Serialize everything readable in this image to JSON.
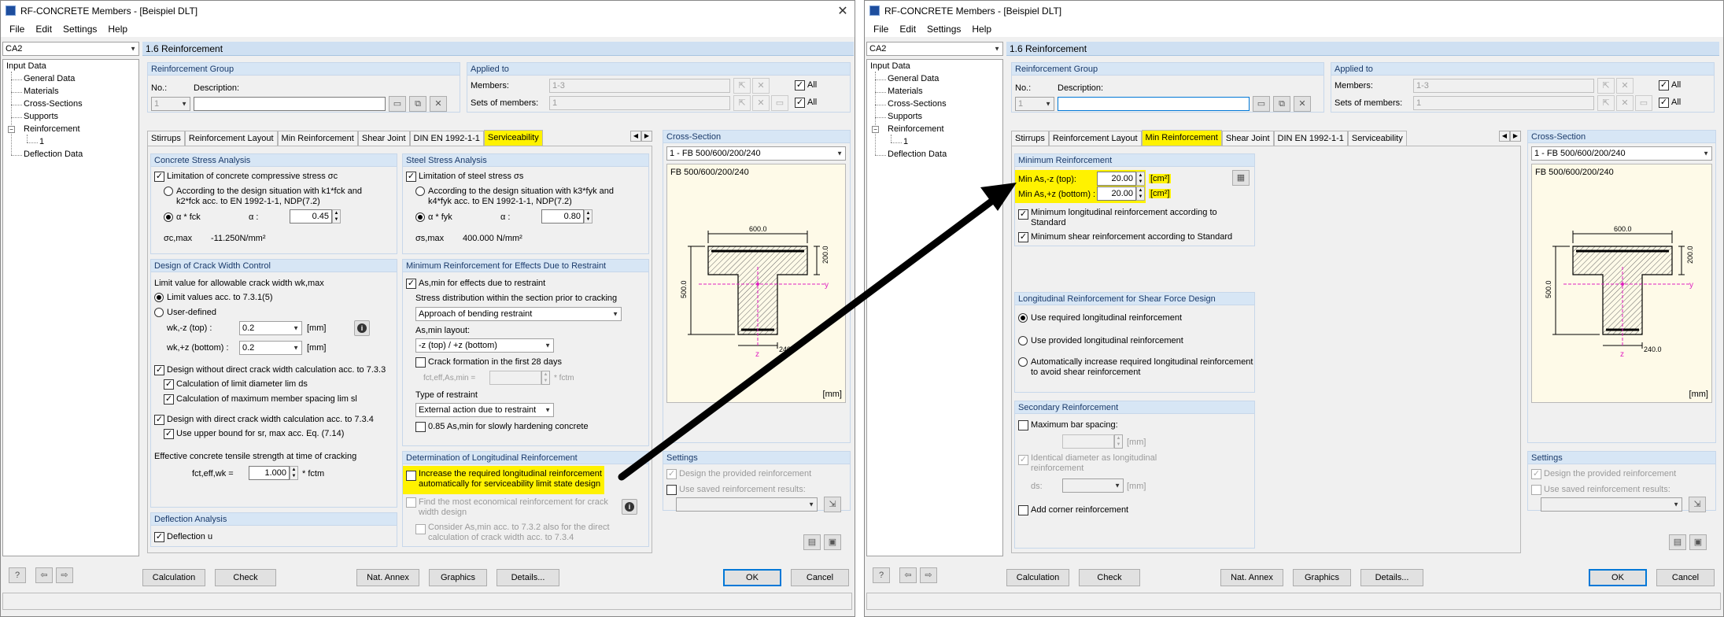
{
  "left": {
    "window_title": "RF-CONCRETE Members - [Beispiel DLT]",
    "menu": [
      "File",
      "Edit",
      "Settings",
      "Help"
    ],
    "case_combo": "CA2",
    "tree": {
      "root": "Input Data",
      "items": [
        "General Data",
        "Materials",
        "Cross-Sections",
        "Supports",
        "Reinforcement",
        "1",
        "Deflection Data"
      ]
    },
    "section_header": "1.6 Reinforcement",
    "reinf_group": {
      "title": "Reinforcement Group",
      "no_label": "No.:",
      "no_value": "1",
      "desc_label": "Description:",
      "desc_value": ""
    },
    "applied_to": {
      "title": "Applied to",
      "members_label": "Members:",
      "members_value": "1-3",
      "sets_label": "Sets of members:",
      "sets_value": "1",
      "all_label": "All"
    },
    "tabs": [
      "Stirrups",
      "Reinforcement Layout",
      "Min Reinforcement",
      "Shear Joint",
      "DIN EN 1992-1-1",
      "Serviceability"
    ],
    "active_tab": "Serviceability",
    "concrete_stress": {
      "title": "Concrete Stress Analysis",
      "limit_label": "Limitation of concrete compressive stress σc",
      "opt1_l1": "According to the design situation with k1*fck and",
      "opt1_l2": "k2*fck acc. to EN 1992-1-1, NDP(7.2)",
      "opt2": "α * fck",
      "alpha_label": "α :",
      "alpha_value": "0.45",
      "sigma_label": "σc,max",
      "sigma_value": "-11.250N/mm²"
    },
    "steel_stress": {
      "title": "Steel Stress Analysis",
      "limit_label": "Limitation of steel stress σs",
      "opt1_l1": "According to the design situation with k3*fyk and",
      "opt1_l2": "k4*fyk acc. to EN 1992-1-1, NDP(7.2)",
      "opt2": "α * fyk",
      "alpha_label": "α :",
      "alpha_value": "0.80",
      "sigma_label": "σs,max",
      "sigma_value": "400.000 N/mm²"
    },
    "crack_width": {
      "title": "Design of Crack Width Control",
      "limit_text": "Limit value for allowable crack width wk,max",
      "opt1": "Limit values acc. to 7.3.1(5)",
      "opt2": "User-defined",
      "wk_top_label": "wk,-z (top) :",
      "wk_top_value": "0.2",
      "wk_bot_label": "wk,+z (bottom) :",
      "wk_bot_value": "0.2",
      "unit": "[mm]",
      "without_direct": "Design without direct crack width calculation acc. to 7.3.3",
      "calc_limit": "Calculation of limit diameter lim ds",
      "calc_max": "Calculation of maximum member spacing lim sl",
      "with_direct": "Design with direct crack width calculation acc. to 7.3.4",
      "upper_bound": "Use upper bound for sr, max acc. Eq. (7.14)",
      "eff_label": "Effective concrete tensile strength at time of cracking",
      "fct_label": "fct,eff,wk =",
      "fct_value": "1.000",
      "fct_unit": "* fctm"
    },
    "deflection": {
      "title": "Deflection Analysis",
      "label": "Deflection u"
    },
    "min_restraint": {
      "title": "Minimum Reinforcement for Effects Due to Restraint",
      "as_min": "As,min for effects due to restraint",
      "stress_dist": "Stress distribution within the section prior to cracking",
      "stress_value": "Approach of bending restraint",
      "layout_label": "As,min layout:",
      "layout_value": "-z (top) / +z (bottom)",
      "crack28": "Crack formation in the first 28 days",
      "fct_label": "fct,eff,As,min =",
      "fct_unit": "* fctm",
      "type_label": "Type of restraint",
      "type_value": "External action due to restraint",
      "slow": "0.85 As,min for slowly hardening concrete"
    },
    "long_reinf": {
      "title": "Determination of Longitudinal Reinforcement",
      "inc_l1": "Increase the required longitudinal reinforcement",
      "inc_l2": "automatically for serviceability limit state design",
      "econ_l1": "Find the most economical reinforcement for crack",
      "econ_l2": "width design",
      "consider_l1": "Consider As,min acc. to 7.3.2 also for the direct",
      "consider_l2": "calculation of crack width acc. to 7.3.4"
    },
    "cross_section": {
      "title": "Cross-Section",
      "combo": "1 - FB 500/600/200/240",
      "label": "FB 500/600/200/240",
      "unit": "[mm]"
    },
    "settings": {
      "title": "Settings",
      "design_provided": "Design the provided reinforcement",
      "use_saved": "Use saved reinforcement results:"
    },
    "buttons": {
      "calculation": "Calculation",
      "check": "Check",
      "nat_annex": "Nat. Annex",
      "graphics": "Graphics",
      "details": "Details...",
      "ok": "OK",
      "cancel": "Cancel"
    }
  },
  "right": {
    "window_title": "RF-CONCRETE Members - [Beispiel DLT]",
    "menu": [
      "File",
      "Edit",
      "Settings",
      "Help"
    ],
    "case_combo": "CA2",
    "tree": {
      "root": "Input Data",
      "items": [
        "General Data",
        "Materials",
        "Cross-Sections",
        "Supports",
        "Reinforcement",
        "1",
        "Deflection Data"
      ]
    },
    "section_header": "1.6 Reinforcement",
    "reinf_group": {
      "title": "Reinforcement Group",
      "no_label": "No.:",
      "no_value": "1",
      "desc_label": "Description:",
      "desc_value": ""
    },
    "applied_to": {
      "title": "Applied to",
      "members_label": "Members:",
      "members_value": "1-3",
      "sets_label": "Sets of members:",
      "sets_value": "1",
      "all_label": "All"
    },
    "tabs": [
      "Stirrups",
      "Reinforcement Layout",
      "Min Reinforcement",
      "Shear Joint",
      "DIN EN 1992-1-1",
      "Serviceability"
    ],
    "active_tab": "Min Reinforcement",
    "min_reinf": {
      "title": "Minimum Reinforcement",
      "top_label": "Min As,-z (top):",
      "top_value": "20.00",
      "bot_label": "Min As,+z (bottom) :",
      "bot_value": "20.00",
      "unit": "[cm²]",
      "min_long_l1": "Minimum longitudinal reinforcement according to",
      "min_long_l2": "Standard",
      "min_shear": "Minimum shear reinforcement according to Standard"
    },
    "long_shear": {
      "title": "Longitudinal Reinforcement for Shear Force Design",
      "opt1": "Use required longitudinal reinforcement",
      "opt2": "Use provided longitudinal reinforcement",
      "opt3_l1": "Automatically increase required longitudinal reinforcement",
      "opt3_l2": "to avoid shear reinforcement"
    },
    "secondary": {
      "title": "Secondary Reinforcement",
      "max_spacing": "Maximum bar spacing:",
      "unit": "[mm]",
      "identical_l1": "Identical diameter as longitudinal",
      "identical_l2": "reinforcement",
      "ds_label": "ds:",
      "corner": "Add corner reinforcement"
    },
    "cross_section": {
      "title": "Cross-Section",
      "combo": "1 - FB 500/600/200/240",
      "label": "FB 500/600/200/240",
      "unit": "[mm]"
    },
    "settings": {
      "title": "Settings",
      "design_provided": "Design the provided reinforcement",
      "use_saved": "Use saved reinforcement results:"
    },
    "buttons": {
      "calculation": "Calculation",
      "check": "Check",
      "nat_annex": "Nat. Annex",
      "graphics": "Graphics",
      "details": "Details...",
      "ok": "OK",
      "cancel": "Cancel"
    }
  },
  "drawing": {
    "dim_top": "600.0",
    "dim_flange": "200.0",
    "dim_height": "500.0",
    "dim_web": "240.0",
    "axis_y": "y",
    "axis_z": "z"
  },
  "colors": {
    "highlight": "#fff200",
    "header_blue": "#cfe0f2",
    "group_title": "#d7e6f5",
    "rebar_magenta": "#e020c0"
  }
}
